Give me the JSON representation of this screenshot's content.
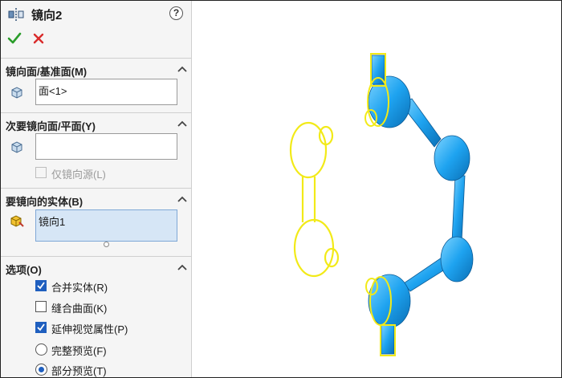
{
  "feature": {
    "title": "镜向2",
    "help_label": "?"
  },
  "actions": {
    "ok_icon": "check-icon",
    "cancel_icon": "close-icon",
    "ok_color": "#2a9d2a",
    "cancel_color": "#d92b2b"
  },
  "mirror_face": {
    "header": "镜向面/基准面(M)",
    "value": "面<1>"
  },
  "secondary_face": {
    "header": "次要镜向面/平面(Y)",
    "value": "",
    "mirror_source_only_label": "仅镜向源(L)",
    "mirror_source_only_checked": false,
    "mirror_source_only_enabled": false
  },
  "bodies": {
    "header": "要镜向的实体(B)",
    "items": [
      "镜向1"
    ]
  },
  "options": {
    "header": "选项(O)",
    "items": [
      {
        "type": "checkbox",
        "label": "合并实体(R)",
        "checked": true
      },
      {
        "type": "checkbox",
        "label": "缝合曲面(K)",
        "checked": false
      },
      {
        "type": "checkbox",
        "label": "延伸视觉属性(P)",
        "checked": true
      },
      {
        "type": "radio",
        "label": "完整预览(F)",
        "checked": false
      },
      {
        "type": "radio",
        "label": "部分预览(T)",
        "checked": true
      }
    ]
  },
  "colors": {
    "model_blue": "#1ea3f0",
    "preview_yellow": "#f2ea18",
    "accent": "#1f5fbf"
  }
}
